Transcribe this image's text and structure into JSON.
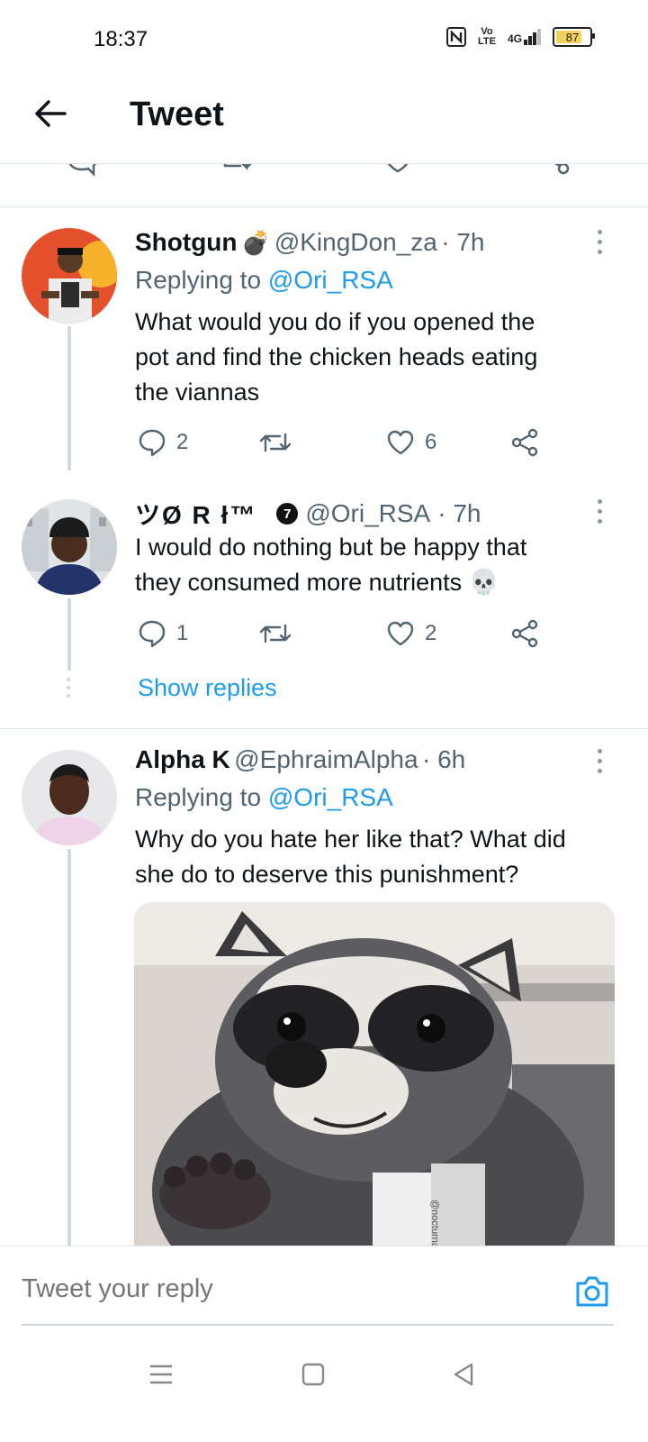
{
  "status_bar": {
    "time": "18:37",
    "network_label": "4G",
    "volte_label": "Vo LTE",
    "battery_level": "87",
    "icons": [
      "nfc-icon",
      "volte-icon",
      "signal-icon",
      "battery-icon"
    ]
  },
  "header": {
    "title": "Tweet",
    "back_icon": "arrow-left-icon"
  },
  "tweets": [
    {
      "name": "Shotgun",
      "emoji": "💣",
      "handle": "@KingDon_za",
      "time": "· 7h",
      "replying_prefix": "Replying to",
      "replying_to": "@Ori_RSA",
      "text_lines": [
        "What would you do if you opened the",
        "pot and find the chicken heads eating",
        "the viannas"
      ],
      "reply_count": "2",
      "retweet_count": "",
      "like_count": "6"
    },
    {
      "name": "ツØ R ł™",
      "badge": "7",
      "handle": "@Ori_RSA",
      "time": "· 7h",
      "text_lines": [
        "I would do nothing but be happy that",
        "they consumed more nutrients 💀"
      ],
      "reply_count": "1",
      "retweet_count": "",
      "like_count": "2"
    },
    {
      "name": "Alpha K",
      "handle": "@EphraimAlpha",
      "time": "· 6h",
      "replying_prefix": "Replying to",
      "replying_to": "@Ori_RSA",
      "text_lines": [
        "Why do you hate her like that? What did",
        "she do to deserve this punishment?"
      ],
      "media_watermark": "@nocturnaltrash"
    }
  ],
  "show_replies": "Show replies",
  "reply_bar": {
    "placeholder": "Tweet your reply"
  },
  "colors": {
    "accent": "#1d9bf0",
    "text": "#0f1419",
    "secondary": "#536471",
    "divider": "#e1e6ea"
  }
}
